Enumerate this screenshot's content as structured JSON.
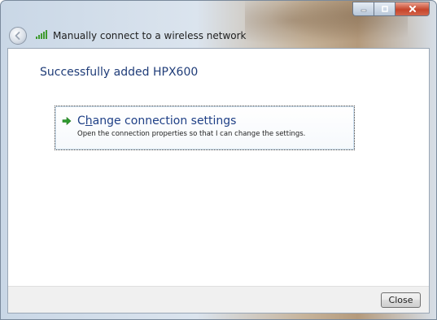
{
  "window": {
    "title": "Manually connect to a wireless network",
    "caption_buttons": {
      "minimize": "–",
      "maximize": "□",
      "close": "x"
    }
  },
  "content": {
    "heading": "Successfully added HPX600",
    "command_link": {
      "title_prefix": "C",
      "title_mnemonic": "h",
      "title_rest": "ange connection settings",
      "description": "Open the connection properties so that I can change the settings."
    }
  },
  "footer": {
    "close_label": "Close"
  },
  "icons": {
    "back": "back-arrow-icon",
    "wifi": "wireless-signal-icon",
    "command_arrow": "green-arrow-icon"
  },
  "colors": {
    "heading": "#1f3c78",
    "link": "#1e3f86",
    "arrow": "#2e9a2e"
  }
}
